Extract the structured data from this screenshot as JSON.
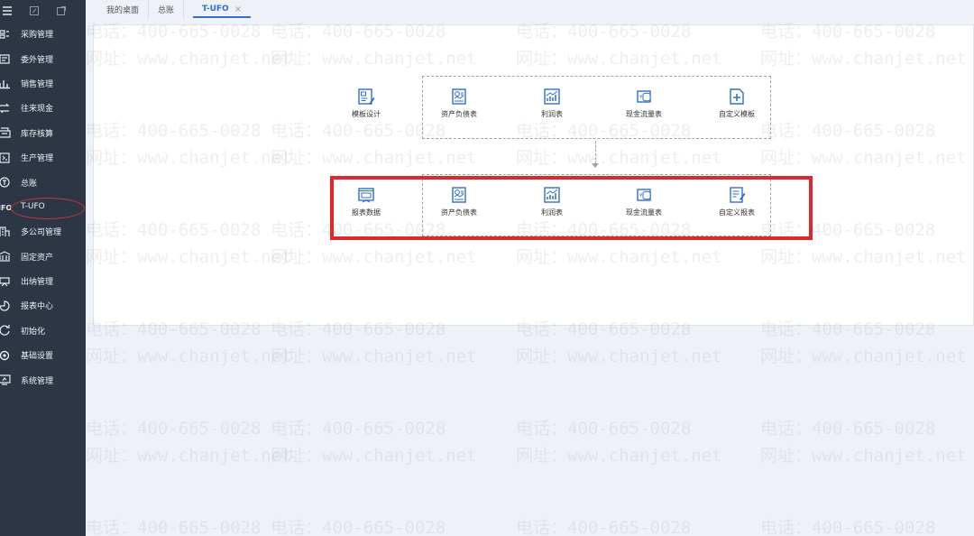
{
  "sidebar": {
    "items": [
      {
        "label": "采购管理",
        "icon": "purchase-icon"
      },
      {
        "label": "委外管理",
        "icon": "outsource-icon"
      },
      {
        "label": "销售管理",
        "icon": "sales-icon"
      },
      {
        "label": "往来现金",
        "icon": "transfer-icon"
      },
      {
        "label": "库存核算",
        "icon": "inventory-icon"
      },
      {
        "label": "生产管理",
        "icon": "production-icon"
      },
      {
        "label": "总账",
        "icon": "ledger-icon"
      },
      {
        "label": "T-UFO",
        "icon": "ufo-icon"
      },
      {
        "label": "多公司管理",
        "icon": "company-icon"
      },
      {
        "label": "固定资产",
        "icon": "asset-icon"
      },
      {
        "label": "出纳管理",
        "icon": "cashier-icon"
      },
      {
        "label": "报表中心",
        "icon": "report-center-icon"
      },
      {
        "label": "初始化",
        "icon": "init-icon"
      },
      {
        "label": "基础设置",
        "icon": "basic-settings-icon"
      },
      {
        "label": "系统管理",
        "icon": "system-icon"
      }
    ]
  },
  "tabs": [
    {
      "label": "我的桌面"
    },
    {
      "label": "总账"
    },
    {
      "label": "T-UFO",
      "close": "×"
    }
  ],
  "flow": {
    "row1": [
      {
        "label": "模板设计",
        "icon": "template-design-icon"
      },
      {
        "label": "资产负债表",
        "icon": "balance-sheet-icon"
      },
      {
        "label": "利润表",
        "icon": "income-statement-icon"
      },
      {
        "label": "现金流量表",
        "icon": "cash-flow-icon"
      },
      {
        "label": "自定义模板",
        "icon": "custom-template-icon"
      }
    ],
    "row2": [
      {
        "label": "报表数据",
        "icon": "report-data-icon"
      },
      {
        "label": "资产负债表",
        "icon": "balance-sheet-icon"
      },
      {
        "label": "利润表",
        "icon": "income-statement-icon"
      },
      {
        "label": "现金流量表",
        "icon": "cash-flow-icon"
      },
      {
        "label": "自定义报表",
        "icon": "custom-report-icon"
      }
    ]
  },
  "watermark": {
    "phone": "电话：400-665-0028",
    "site": "网址：www.chanjet.net"
  },
  "colors": {
    "sidebar_bg": "#2c3645",
    "accent": "#2f6fd0",
    "highlight": "#e0272c"
  }
}
